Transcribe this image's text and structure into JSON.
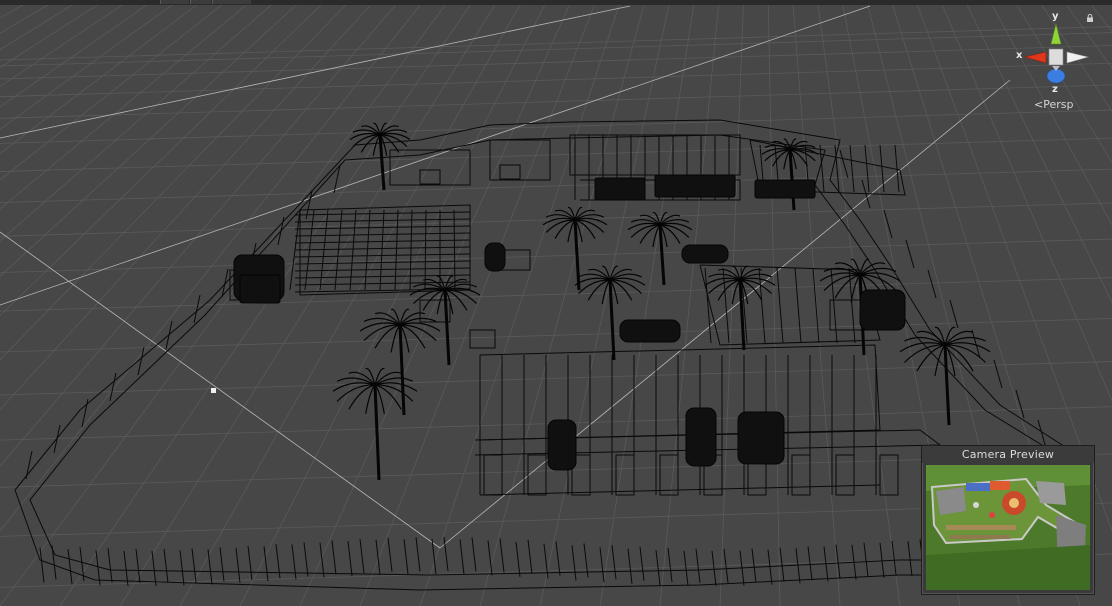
{
  "scene": {
    "projection_label": "Persp"
  },
  "gizmo": {
    "axis_y": "y",
    "axis_x": "x",
    "axis_z": "z",
    "colors": {
      "y": "#8fd23b",
      "x": "#e0361c",
      "z": "#3c7de0",
      "neutral": "#e8e8e8"
    }
  },
  "camera_preview": {
    "title": "Camera Preview"
  },
  "colors": {
    "background": "#474747",
    "grid": "#5c5c5c",
    "wire": "#0b0b0b"
  }
}
